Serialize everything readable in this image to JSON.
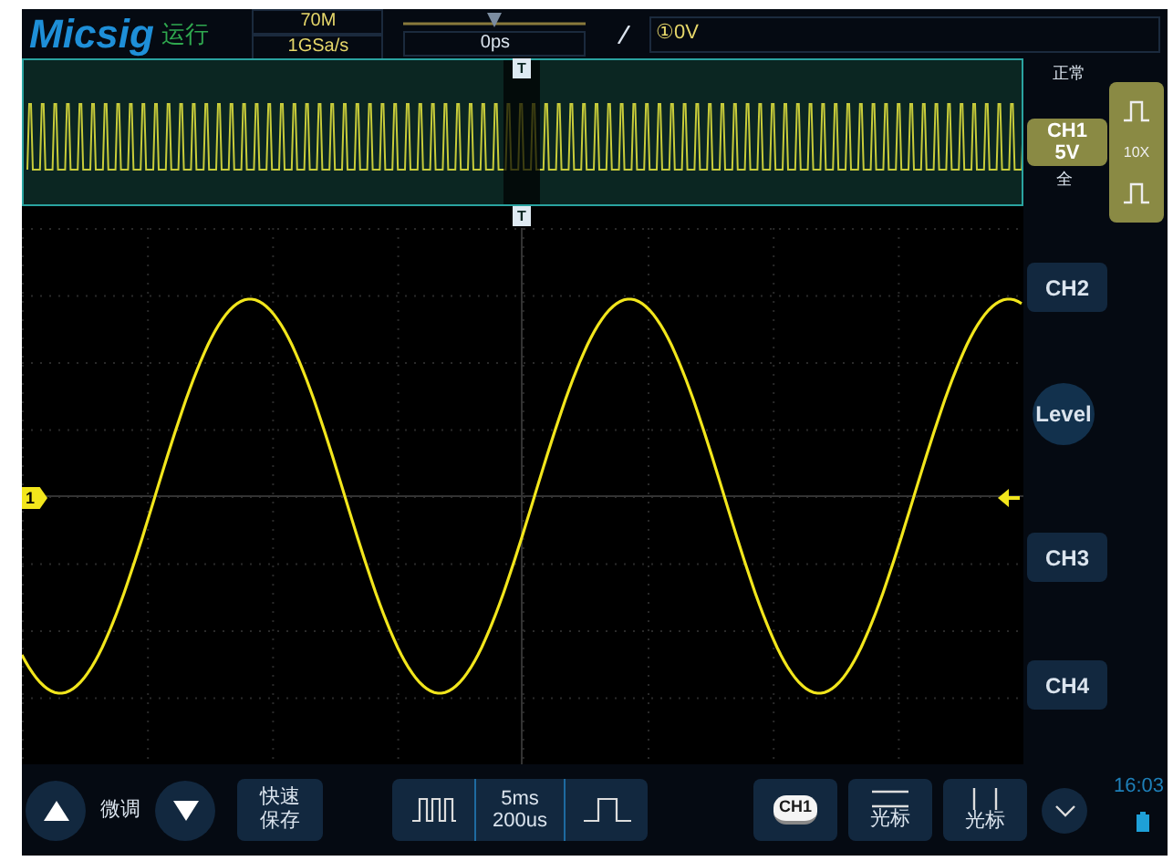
{
  "header": {
    "logo": "Micsig",
    "run_state": "运行",
    "bandwidth": "70M",
    "sample_rate": "1GSa/s",
    "time_position": {
      "level": 0.5
    },
    "time_offset": "0ps",
    "trigger_level": "①0V"
  },
  "overview": {
    "trigger_marker_top": "T",
    "trigger_marker_bottom": "T"
  },
  "trigger_marker": "1",
  "side_panel": {
    "acquire_mode": "正常",
    "coupling": "全",
    "probe": "10X"
  },
  "channels": [
    {
      "label": "CH1",
      "scale": "5V",
      "selected": true
    },
    {
      "label": "CH2",
      "selected": false
    },
    {
      "label": "CH3",
      "selected": false
    },
    {
      "label": "CH4",
      "selected": false
    }
  ],
  "level_button": "Level",
  "bottom_bar": {
    "fine_tune": "微调",
    "quick_save": [
      "快速",
      "保存"
    ],
    "timebase": "5ms",
    "zoom_timebase": "200us",
    "cursor_channel": "CH1",
    "cursor_h": "光标",
    "cursor_v": "光标",
    "clock": "16:03"
  }
}
